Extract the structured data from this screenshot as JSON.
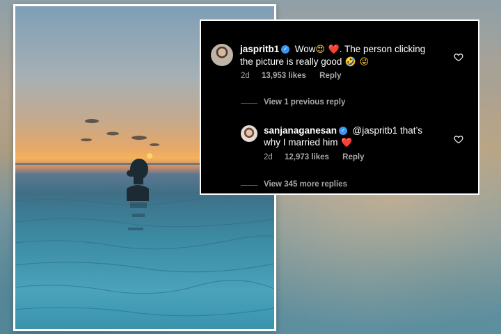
{
  "comment1": {
    "username": "jaspritb1",
    "text_part1": "Wow",
    "emoji1": "😍",
    "emoji2": "❤️",
    "text_part2": ". The person clicking",
    "text_line2": "the picture is really good",
    "emoji3": "🤣",
    "emoji4": "😜",
    "time": "2d",
    "likes": "13,953 likes",
    "reply_label": "Reply"
  },
  "view_previous": "View 1 previous reply",
  "comment2": {
    "username": "sanjanaganesan",
    "text_line1": "@jaspritb1 that’s",
    "text_line2": "why I married him",
    "emoji1": "❤️",
    "time": "2d",
    "likes": "12,973 likes",
    "reply_label": "Reply"
  },
  "view_more": "View 345 more replies",
  "colors": {
    "verified": "#3897f0",
    "heart": "#e0245e",
    "meta_text": "#a8a8a8"
  },
  "icons": [
    "verified-badge-icon",
    "heart-outline-icon"
  ]
}
